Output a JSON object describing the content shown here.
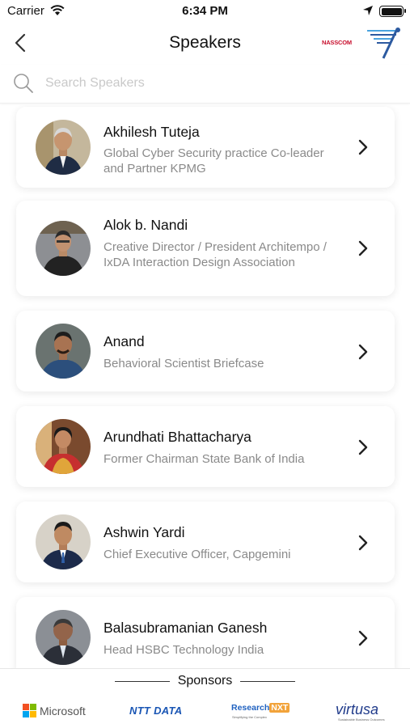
{
  "status_bar": {
    "carrier": "Carrier",
    "time": "6:34 PM"
  },
  "nav": {
    "title": "Speakers",
    "brand": "NASSCOM"
  },
  "search": {
    "placeholder": "Search Speakers",
    "value": ""
  },
  "speakers": [
    {
      "name": "Akhilesh Tuteja",
      "title": "Global Cyber Security practice Co-leader and Partner KPMG"
    },
    {
      "name": "Alok b. Nandi",
      "title": "Creative Director / President Architempo / IxDA Interaction Design Association"
    },
    {
      "name": "Anand",
      "title": "Behavioral Scientist Briefcase"
    },
    {
      "name": "Arundhati Bhattacharya",
      "title": "Former Chairman State Bank of India"
    },
    {
      "name": "Ashwin Yardi",
      "title": "Chief Executive Officer, Capgemini"
    },
    {
      "name": "Balasubramanian Ganesh",
      "title": "Head HSBC Technology India"
    }
  ],
  "sponsors": {
    "title": "Sponsors",
    "logos": [
      {
        "name": "Microsoft"
      },
      {
        "name": "NTT DATA"
      },
      {
        "name": "Research",
        "badge": "NXT",
        "tagline": "Simplifying the Complex"
      },
      {
        "name": "virtusa",
        "tagline": "Sustainable Business Outcomes"
      }
    ]
  },
  "colors": {
    "accent": "#1a56b4",
    "text_secondary": "#8a8a8a",
    "nasscom_red": "#c8102e"
  },
  "icons": {
    "back": "chevron-left-icon",
    "search": "search-icon",
    "row_action": "chevron-right-icon",
    "status": [
      "wifi-icon",
      "location-arrow-icon",
      "battery-icon"
    ]
  }
}
